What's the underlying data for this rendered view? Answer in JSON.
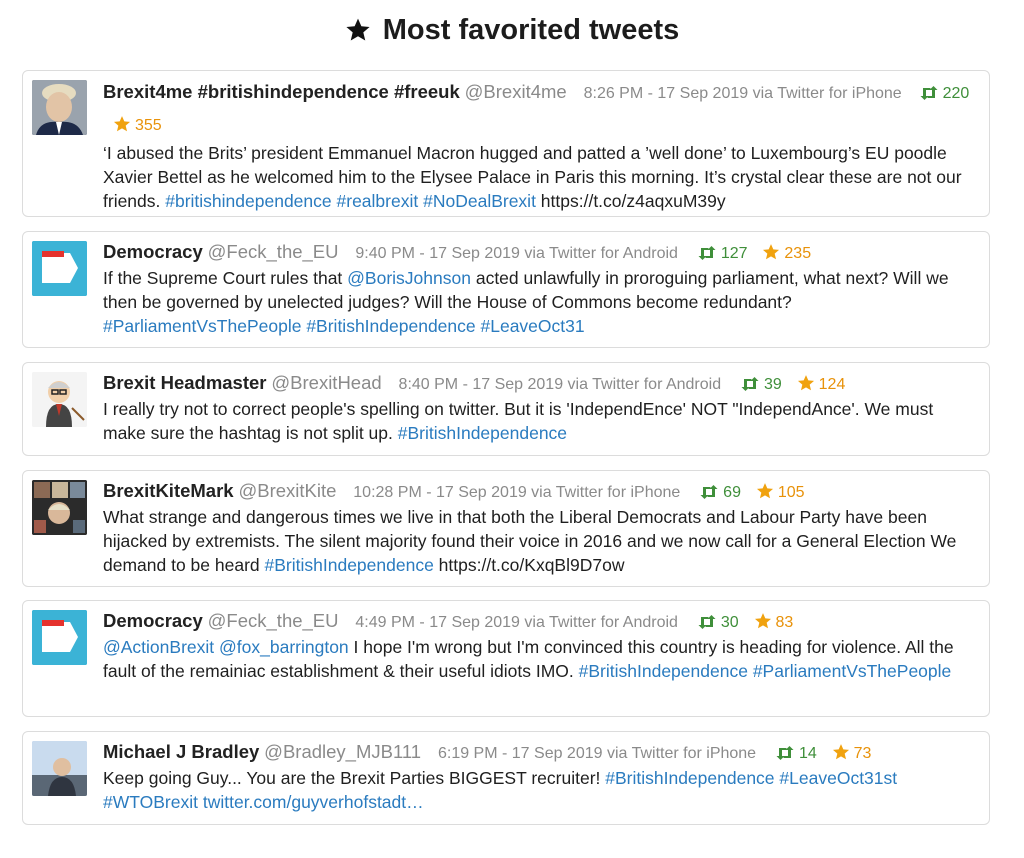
{
  "page_title": "Most favorited tweets",
  "icons": {
    "title": "star-icon",
    "retweet": "retweet-icon",
    "favorite": "star-icon"
  },
  "colors": {
    "retweet": "#3f8f3a",
    "favorite": "#e8920a",
    "hashtag": "#2a7bbf",
    "meta": "#8a8a8a"
  },
  "tweets": [
    {
      "name": "Brexit4me #britishindependence #freeuk",
      "handle": "@Brexit4me",
      "meta": "8:26 PM - 17 Sep 2019 via Twitter for iPhone",
      "retweets": "220",
      "favorites": "355",
      "parts": [
        {
          "t": "‘I abused the Brits’ president Emmanuel Macron hugged and patted a ’well done’ to Luxembourg’s EU poodle Xavier Bettel as he welcomed him to the Elysee Palace in Paris this morning. It’s crystal clear these are not our friends. "
        },
        {
          "t": "#britishindependence",
          "k": "tag"
        },
        {
          "t": " "
        },
        {
          "t": "#realbrexit",
          "k": "tag"
        },
        {
          "t": " "
        },
        {
          "t": "#NoDealBrexit",
          "k": "tag"
        },
        {
          "t": " https://t.co/z4aqxuM39y"
        }
      ]
    },
    {
      "name": "Democracy",
      "handle": "@Feck_the_EU",
      "meta": "9:40 PM - 17 Sep 2019 via Twitter for Android",
      "retweets": "127",
      "favorites": "235",
      "parts": [
        {
          "t": "If the Supreme Court rules that "
        },
        {
          "t": "@BorisJohnson",
          "k": "tag"
        },
        {
          "t": " acted unlawfully in proroguing parliament, what next? Will we then be governed by unelected judges? Will the House of Commons become redundant? "
        },
        {
          "t": "#ParliamentVsThePeople",
          "k": "tag"
        },
        {
          "t": " "
        },
        {
          "t": "#BritishIndependence",
          "k": "tag"
        },
        {
          "t": " "
        },
        {
          "t": "#LeaveOct31",
          "k": "tag"
        }
      ]
    },
    {
      "name": "Brexit Headmaster",
      "handle": "@BrexitHead",
      "meta": "8:40 PM - 17 Sep 2019 via Twitter for Android",
      "retweets": "39",
      "favorites": "124",
      "parts": [
        {
          "t": "I really try not to correct people's spelling on twitter. But it is 'IndependEnce' NOT \"IndependAnce'. We must make sure the hashtag is not split up. "
        },
        {
          "t": "#BritishIndependence",
          "k": "tag"
        }
      ]
    },
    {
      "name": "BrexitKiteMark",
      "handle": "@BrexitKite",
      "meta": "10:28 PM - 17 Sep 2019 via Twitter for iPhone",
      "retweets": "69",
      "favorites": "105",
      "parts": [
        {
          "t": "What strange and dangerous times we live in that both the Liberal Democrats and Labour Party have been hijacked by extremists. The silent majority found their voice in 2016 and we now call for a General Election We demand to be heard "
        },
        {
          "t": "#BritishIndependence",
          "k": "tag"
        },
        {
          "t": " https://t.co/KxqBl9D7ow"
        }
      ]
    },
    {
      "name": "Democracy",
      "handle": "@Feck_the_EU",
      "meta": "4:49 PM - 17 Sep 2019 via Twitter for Android",
      "retweets": "30",
      "favorites": "83",
      "parts": [
        {
          "t": "@ActionBrexit",
          "k": "tag"
        },
        {
          "t": " "
        },
        {
          "t": "@fox_barrington",
          "k": "tag"
        },
        {
          "t": " I hope I'm wrong but I'm convinced this country is heading for violence. All the fault of the remainiac establishment & their useful idiots IMO. "
        },
        {
          "t": "#BritishIndependence",
          "k": "tag"
        },
        {
          "t": " "
        },
        {
          "t": "#ParliamentVsThePeople",
          "k": "tag"
        }
      ]
    },
    {
      "name": "Michael J Bradley",
      "handle": "@Bradley_MJB111",
      "meta": "6:19 PM - 17 Sep 2019 via Twitter for iPhone",
      "retweets": "14",
      "favorites": "73",
      "parts": [
        {
          "t": "Keep going Guy... You are the Brexit Parties BIGGEST recruiter! "
        },
        {
          "t": "#BritishIndependence",
          "k": "tag"
        },
        {
          "t": " "
        },
        {
          "t": "#LeaveOct31st",
          "k": "tag"
        },
        {
          "t": " "
        },
        {
          "t": "#WTOBrexit",
          "k": "tag"
        },
        {
          "t": " "
        },
        {
          "t": "twitter.com/guyverhofstadt…",
          "k": "tag"
        }
      ]
    }
  ]
}
